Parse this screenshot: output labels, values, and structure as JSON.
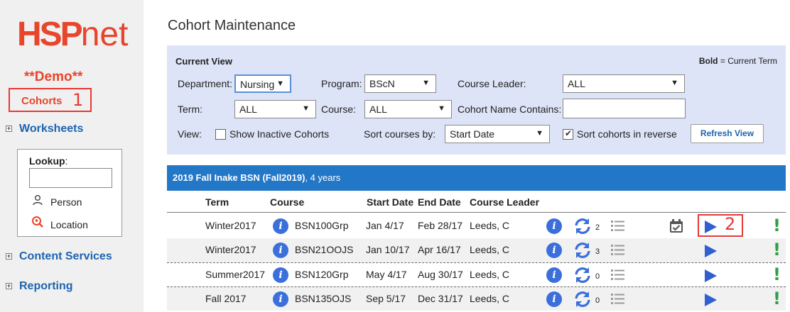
{
  "sidebar": {
    "logo_hsp": "HSP",
    "logo_net": "net",
    "demo": "**Demo**",
    "cohorts": "Cohorts",
    "annotation_1": "1",
    "worksheets": "Worksheets",
    "lookup_label": "Lookup",
    "lookup_colon": ":",
    "lookup_person": "Person",
    "lookup_location": "Location",
    "content_services": "Content Services",
    "reporting": "Reporting"
  },
  "page": {
    "title": "Cohort Maintenance"
  },
  "current_view": {
    "title": "Current View",
    "note_bold": "Bold",
    "note_rest": " = Current Term",
    "department_label": "Department:",
    "department_value": "Nursing",
    "program_label": "Program:",
    "program_value": "BScN",
    "course_leader_label": "Course Leader:",
    "course_leader_value": "ALL",
    "term_label": "Term:",
    "term_value": "ALL",
    "course_label": "Course:",
    "course_value": "ALL",
    "cohort_name_label": "Cohort Name Contains:",
    "cohort_name_value": "",
    "view_label": "View:",
    "show_inactive_label": "Show Inactive Cohorts",
    "show_inactive_checked": false,
    "sort_by_label": "Sort courses by:",
    "sort_by_value": "Start Date",
    "sort_reverse_label": "Sort cohorts in reverse",
    "sort_reverse_checked": true,
    "refresh_button": "Refresh View"
  },
  "cohort": {
    "name": "2019 Fall Inake BSN (Fall2019)",
    "duration": ", 4 years"
  },
  "table": {
    "headers": [
      "Term",
      "Course",
      "Start Date",
      "End Date",
      "Course Leader"
    ],
    "rows": [
      {
        "term": "Winter2017",
        "course": "BSN100Grp",
        "start": "Jan 4/17",
        "end": "Feb 28/17",
        "leader": "Leeds, C",
        "count": "2"
      },
      {
        "term": "Winter2017",
        "course": "BSN21OOJS",
        "start": "Jan 10/17",
        "end": "Apr 16/17",
        "leader": "Leeds, C",
        "count": "3"
      },
      {
        "term": "Summer2017",
        "course": "BSN120Grp",
        "start": "May 4/17",
        "end": "Aug 30/17",
        "leader": "Leeds, C",
        "count": "0"
      },
      {
        "term": "Fall 2017",
        "course": "BSN135OJS",
        "start": "Sep 5/17",
        "end": "Dec 31/17",
        "leader": "Leeds, C",
        "count": "0"
      }
    ],
    "exclamation": "!",
    "info_glyph": "i"
  },
  "annotation_2": "2",
  "colors": {
    "brand": "#e8452c",
    "link": "#1c64b0",
    "cohort_bar": "#2377c7",
    "panel": "#dde4f7",
    "icon_blue": "#3a6fdc",
    "status_green": "#2ea043",
    "annotation_red": "#e53935"
  }
}
